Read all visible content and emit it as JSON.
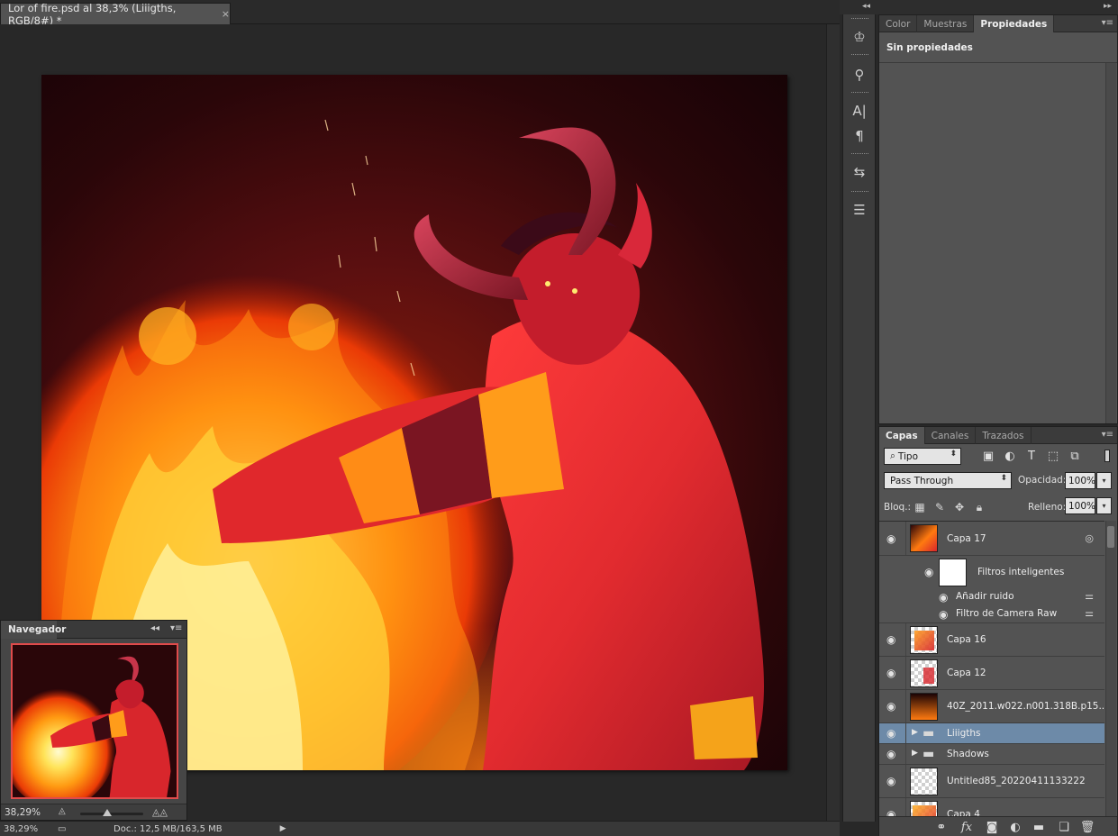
{
  "document": {
    "tab_title": "Lor of fire.psd al 38,3% (Liiigths, RGB/8#) *",
    "close_glyph": "×"
  },
  "statusbar": {
    "zoom": "38,29%",
    "doc_info": "Doc.: 12,5 MB/163,5 MB"
  },
  "navigator": {
    "title": "Navegador",
    "zoom": "38,29%"
  },
  "properties_panel": {
    "tabs": [
      "Color",
      "Muestras",
      "Propiedades"
    ],
    "active_tab": "Propiedades",
    "empty_text": "Sin propiedades"
  },
  "layers_panel": {
    "tabs": [
      "Capas",
      "Canales",
      "Trazados"
    ],
    "active_tab": "Capas",
    "filter_kind": "Tipo",
    "blend_mode": "Pass Through",
    "opacity_label": "Opacidad:",
    "opacity_value": "100%",
    "lock_label": "Bloq.:",
    "fill_label": "Relleno:",
    "fill_value": "100%",
    "layers": [
      {
        "name": "Capa 17",
        "type": "smart",
        "selected": false
      },
      {
        "name": "Filtros inteligentes",
        "type": "smart-filters",
        "selected": false
      },
      {
        "name": "Añadir ruido",
        "type": "filter",
        "selected": false
      },
      {
        "name": "Filtro de Camera Raw",
        "type": "filter",
        "selected": false
      },
      {
        "name": "Capa 16",
        "type": "pixel",
        "selected": false
      },
      {
        "name": "Capa 12",
        "type": "pixel",
        "selected": false
      },
      {
        "name": "40Z_2011.w022.n001.318B.p15....",
        "type": "smart",
        "selected": false
      },
      {
        "name": "Liiigths",
        "type": "group",
        "selected": true
      },
      {
        "name": "Shadows",
        "type": "group",
        "selected": false
      },
      {
        "name": "Untitled85_20220411133222",
        "type": "pixel",
        "selected": false
      },
      {
        "name": "Capa 4",
        "type": "pixel",
        "selected": false
      }
    ]
  },
  "colors": {
    "selection": "#6d8aa8",
    "panel_bg": "#535353",
    "workspace_bg": "#282828"
  }
}
